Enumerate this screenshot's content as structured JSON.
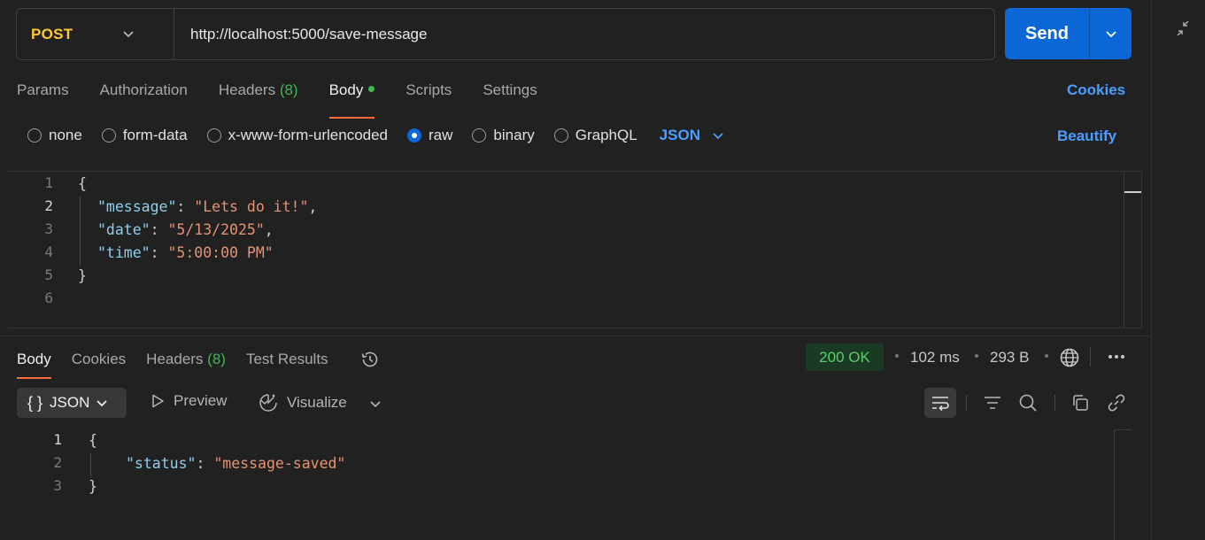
{
  "request": {
    "method": "POST",
    "url": "http://localhost:5000/save-message",
    "send_label": "Send"
  },
  "request_tabs": [
    {
      "label": "Params"
    },
    {
      "label": "Authorization"
    },
    {
      "label": "Headers",
      "count": "(8)"
    },
    {
      "label": "Body",
      "active": true,
      "indicator": "green-dot"
    },
    {
      "label": "Scripts"
    },
    {
      "label": "Settings"
    }
  ],
  "cookies_label": "Cookies",
  "body_types": {
    "options": [
      "none",
      "form-data",
      "x-www-form-urlencoded",
      "raw",
      "binary",
      "GraphQL"
    ],
    "selected": "raw",
    "language": "JSON",
    "beautify_label": "Beautify"
  },
  "request_body": {
    "line_numbers": [
      "1",
      "2",
      "3",
      "4",
      "5",
      "6"
    ],
    "open_brace": "{",
    "close_brace": "}",
    "fields": [
      {
        "key": "\"message\"",
        "value": "\"Lets do it!\"",
        "trail": ","
      },
      {
        "key": "\"date\"",
        "value": "\"5/13/2025\"",
        "trail": ","
      },
      {
        "key": "\"time\"",
        "value": "\"5:00:00 PM\"",
        "trail": ""
      }
    ]
  },
  "response_tabs": [
    {
      "label": "Body",
      "active": true
    },
    {
      "label": "Cookies"
    },
    {
      "label": "Headers",
      "count": "(8)"
    },
    {
      "label": "Test Results"
    }
  ],
  "response_meta": {
    "status": "200 OK",
    "time": "102 ms",
    "size": "293 B",
    "status_color": "#56d364"
  },
  "response_toolbar": {
    "format_icon": "{ }",
    "format": "JSON",
    "preview_label": "Preview",
    "visualize_label": "Visualize"
  },
  "response_body": {
    "line_numbers": [
      "1",
      "2",
      "3"
    ],
    "open_brace": "{",
    "close_brace": "}",
    "key": "\"status\"",
    "value": "\"message-saved\""
  },
  "colors": {
    "accent_blue": "#0b66d6",
    "link_blue": "#4a9eff",
    "method_yellow": "#ffc832",
    "tab_underline": "#ff6c37",
    "json_key": "#8ccff0",
    "json_string": "#e49273"
  }
}
